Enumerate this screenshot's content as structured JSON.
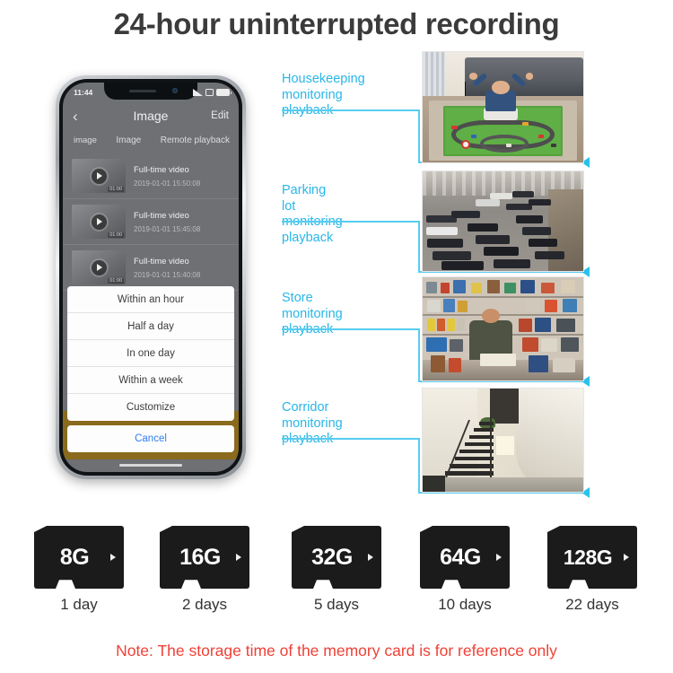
{
  "header": {
    "title": "24-hour uninterrupted recording"
  },
  "phone": {
    "status_bar": {
      "time": "11:44",
      "icons": [
        "signal-icon",
        "wifi-icon",
        "battery-icon"
      ]
    },
    "nav_bar": {
      "back_icon": "chevron-left-icon",
      "title": "Image",
      "edit_label": "Edit"
    },
    "tabs": [
      {
        "label": "image"
      },
      {
        "label": "Image"
      },
      {
        "label": "Remote playback"
      }
    ],
    "video_list": [
      {
        "title": "Full-time video",
        "timestamp": "2019-01-01 15:50:08",
        "duration": "01:00"
      },
      {
        "title": "Full-time video",
        "timestamp": "2019-01-01 15:45:08",
        "duration": "01:00"
      },
      {
        "title": "Full-time video",
        "timestamp": "2019-01-01 15:40:08",
        "duration": "01:00"
      }
    ],
    "action_sheet": {
      "options": [
        {
          "label": "Within an hour"
        },
        {
          "label": "Half a day"
        },
        {
          "label": "In one day"
        },
        {
          "label": "Within a week"
        },
        {
          "label": "Customize"
        }
      ],
      "cancel_label": "Cancel"
    }
  },
  "features": [
    {
      "label": "Housekeeping\nmonitoring playback",
      "scene": "child playing on a play mat in a living room with gray sofa"
    },
    {
      "label": "Parking lot\nmonitoring playback",
      "scene": "aerial view of a parking lot filled with dark cars"
    },
    {
      "label": "Store monitoring\nplayback",
      "scene": "shopkeeper standing behind the counter of a crowded shop"
    },
    {
      "label": "Corridor monitoring\nplayback",
      "scene": "indoor stairwell corridor with dark stairs and light walls"
    }
  ],
  "memory_cards": [
    {
      "capacity": "8G",
      "days": "1 day"
    },
    {
      "capacity": "16G",
      "days": "2 days"
    },
    {
      "capacity": "32G",
      "days": "5 days"
    },
    {
      "capacity": "64G",
      "days": "10 days"
    },
    {
      "capacity": "128G",
      "days": "22 days"
    }
  ],
  "note": "Note: The storage time of the memory card is for reference only",
  "colors": {
    "accent_cyan": "#29b6e8",
    "note_red": "#ef4136",
    "title_gray": "#3b3b3b",
    "card_black": "#1b1b1b"
  }
}
